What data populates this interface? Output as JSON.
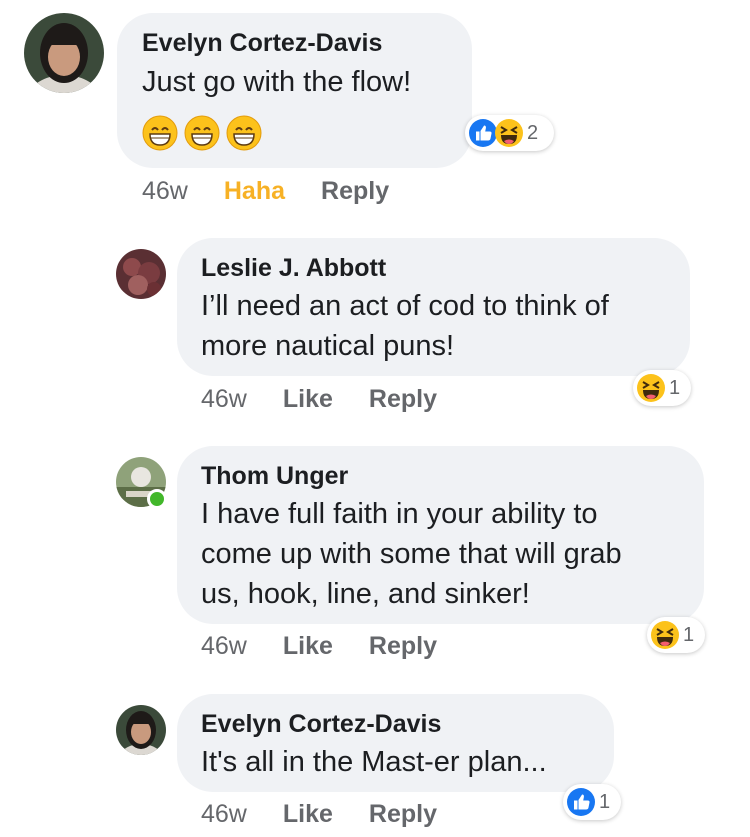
{
  "comments": [
    {
      "author": "Evelyn Cortez-Davis",
      "text": "Just go with the flow!",
      "emoji": [
        "grinning-face",
        "grinning-face",
        "grinning-face"
      ],
      "time": "46w",
      "reaction_action": "Haha",
      "reply_label": "Reply",
      "reactions": [
        "like",
        "haha"
      ],
      "reaction_count": "2"
    },
    {
      "author": "Leslie J. Abbott",
      "text_lines": [
        "I’ll need an act of cod to think of",
        "more nautical puns!"
      ],
      "time": "46w",
      "like_label": "Like",
      "reply_label": "Reply",
      "reactions": [
        "haha"
      ],
      "reaction_count": "1"
    },
    {
      "author": "Thom Unger",
      "text_lines": [
        "I have full faith in your ability to",
        "come up with some that will grab",
        "us, hook, line, and sinker!"
      ],
      "time": "46w",
      "like_label": "Like",
      "reply_label": "Reply",
      "reactions": [
        "haha"
      ],
      "reaction_count": "1",
      "online": true
    },
    {
      "author": "Evelyn Cortez-Davis",
      "text": "It's all in the Mast-er plan...",
      "time": "46w",
      "like_label": "Like",
      "reply_label": "Reply",
      "reactions": [
        "like"
      ],
      "reaction_count": "1"
    }
  ],
  "colors": {
    "bubble": "#f0f2f5",
    "meta_text": "#65676b",
    "haha_active": "#f7b125",
    "like_blue": "#1877f2",
    "online": "#42b72a"
  }
}
